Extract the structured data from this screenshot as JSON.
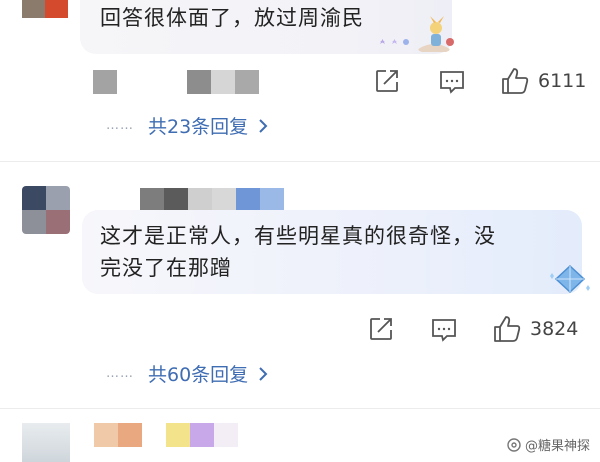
{
  "comment1": {
    "text": "回答很体面了，放过周渝民",
    "like_count": "6111",
    "replies_text": "共23条回复",
    "dots": "……"
  },
  "comment2": {
    "text_line1": "这才是正常人，有些明星真的很奇怪，没",
    "text_line2": "完没了在那蹭",
    "like_count": "3824",
    "replies_text": "共60条回复",
    "dots": "……"
  },
  "watermark": {
    "text": "@糖果神探"
  },
  "colors": {
    "link": "#3f6db3",
    "icon": "#555555"
  }
}
